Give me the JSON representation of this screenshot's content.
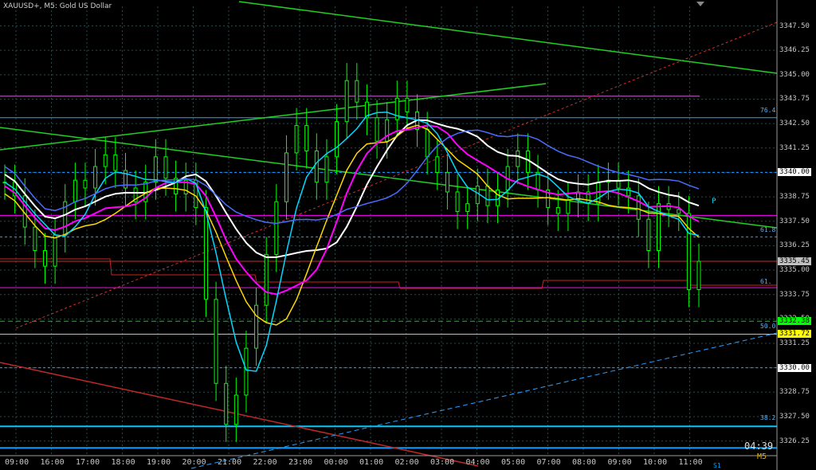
{
  "title": "XAUUSD+, M5:  Gold US Dollar",
  "timer": "04:39",
  "timeframe": "M5",
  "pivot_label": "P",
  "s1_label": "S1",
  "price_axis": [
    "3347.50",
    "3346.25",
    "3345.00",
    "3343.75",
    "3342.50",
    "3341.25",
    "3340.00",
    "3338.75",
    "3337.50",
    "3336.25",
    "3335.00",
    "3333.75",
    "3332.50",
    "3331.25",
    "3330.00",
    "3328.75",
    "3327.50",
    "3326.25"
  ],
  "price_tags": [
    {
      "price": "3340.00",
      "bg": "#ffffff",
      "fg": "#000000"
    },
    {
      "price": "3335.45",
      "bg": "#c0c0c0",
      "fg": "#000000"
    },
    {
      "price": "3332.38",
      "bg": "#00ff00",
      "fg": "#000000"
    },
    {
      "price": "3331.72",
      "bg": "#ffff00",
      "fg": "#000000"
    },
    {
      "price": "3330.00",
      "bg": "#ffffff",
      "fg": "#000000"
    }
  ],
  "fib_labels": [
    "76.4",
    "61.8",
    "61.",
    "50.0",
    "38.2"
  ],
  "time_axis": [
    "09:00",
    "16:00",
    "17:00",
    "18:00",
    "19:00",
    "20:00",
    "21:00",
    "22:00",
    "23:00",
    "00:00",
    "01:00",
    "02:00",
    "03:00",
    "04:00",
    "05:00",
    "07:00",
    "08:00",
    "09:00",
    "10:00",
    "11:00"
  ],
  "colors": {
    "candles": "#00ff00",
    "grid": "#2a4a4a",
    "ma_white": "#ffffff",
    "ma_yellow": "#ffd800",
    "ma_magenta": "#ff00ff",
    "ma_cyan": "#00d8ff",
    "ma_blue": "#4a6cff",
    "trend_green": "#20d020",
    "pivot_red": "#cc2020",
    "fib_blue": "#2aa0ff"
  },
  "chart_data": {
    "type": "candlestick",
    "symbol": "XAUUSD+",
    "timeframe": "M5",
    "ylim": [
      3325.5,
      3348.5
    ],
    "close_series": [
      3339.5,
      3338.8,
      3337.2,
      3336.0,
      3335.2,
      3336.8,
      3338.5,
      3339.6,
      3339.2,
      3340.3,
      3340.9,
      3340.1,
      3339.2,
      3338.5,
      3339.5,
      3340.8,
      3339.7,
      3338.9,
      3339.6,
      3338.2,
      3333.5,
      3329.2,
      3327.1,
      3328.6,
      3331.0,
      3333.2,
      3335.8,
      3338.5,
      3341.0,
      3342.4,
      3341.1,
      3339.5,
      3340.8,
      3342.6,
      3344.7,
      3343.6,
      3342.8,
      3341.6,
      3342.7,
      3343.8,
      3343.1,
      3342.2,
      3340.8,
      3340.0,
      3339.0,
      3338.0,
      3338.4,
      3339.3,
      3338.3,
      3339.1,
      3340.3,
      3341.1,
      3340.0,
      3339.1,
      3338.2,
      3337.9,
      3338.6,
      3339.0,
      3338.4,
      3339.5,
      3339.6,
      3339.2,
      3338.8,
      3337.6,
      3336.0,
      3338.4,
      3338.1,
      3337.9,
      3334.0,
      3335.45
    ]
  }
}
